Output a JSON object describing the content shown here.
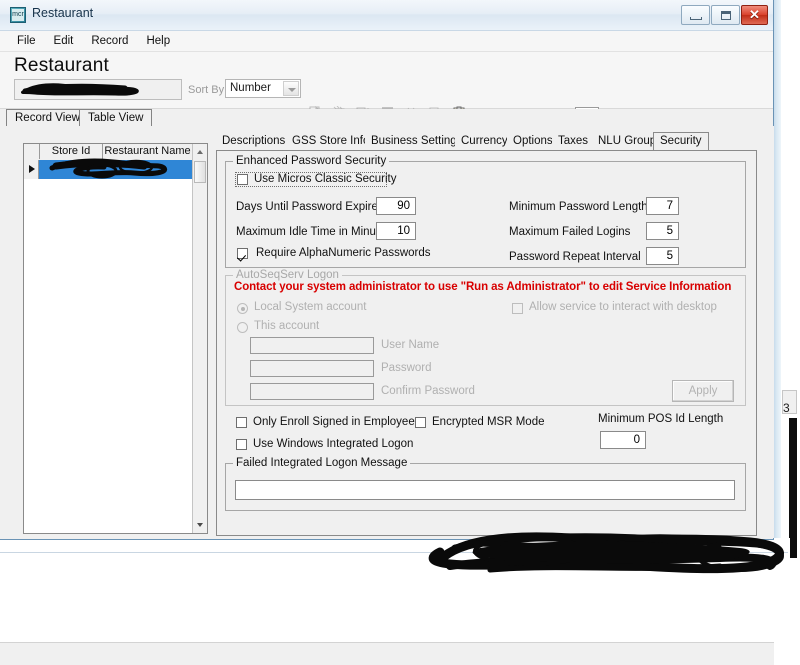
{
  "window": {
    "title": "Restaurant",
    "app_icon": "app-icon",
    "buttons": {
      "minimize": "minimize",
      "maximize": "maximize",
      "close": "close"
    }
  },
  "menu": {
    "items": [
      {
        "label": "File"
      },
      {
        "label": "Edit"
      },
      {
        "label": "Record"
      },
      {
        "label": "Help"
      }
    ]
  },
  "header": {
    "title": "Restaurant",
    "record_name": "",
    "sort_by_label": "Sort By",
    "sort_by_value": "Number",
    "toolbar_top": [
      {
        "name": "new-record-icon"
      },
      {
        "name": "copy-record-icon"
      },
      {
        "name": "paste-record-icon"
      },
      {
        "name": "delete-record-icon"
      },
      {
        "name": "cut-icon"
      },
      {
        "name": "export-icon"
      },
      {
        "name": "clipboard-icon"
      },
      {
        "name": "sparkle-icon"
      }
    ],
    "toolbar_nav": [
      {
        "name": "first-record-icon"
      },
      {
        "name": "previous-record-icon"
      },
      {
        "name": "next-record-icon"
      },
      {
        "name": "last-record-icon"
      },
      {
        "name": "edit-record-icon"
      },
      {
        "name": "undo-icon"
      },
      {
        "name": "add-record-icon"
      },
      {
        "name": "remove-record-icon"
      }
    ],
    "toolbar_right_top": [
      {
        "name": "find-binoculars-icon"
      },
      {
        "name": "help-book-icon"
      },
      {
        "name": "whats-this-help-icon"
      }
    ],
    "toolbar_right_bottom": [
      {
        "name": "monitor-icon"
      },
      {
        "name": "network-sync-icon"
      }
    ]
  },
  "view_tabs": [
    {
      "label": "Record View",
      "active": true
    },
    {
      "label": "Table View",
      "active": false
    }
  ],
  "grid": {
    "columns": [
      "Store Id",
      "Restaurant Name"
    ],
    "rows": [
      {
        "store_id": "",
        "restaurant_name": ""
      }
    ]
  },
  "settings_tabs": [
    {
      "label": "Descriptions",
      "active": false
    },
    {
      "label": "GSS Store Info",
      "active": false
    },
    {
      "label": "Business Settings",
      "active": false
    },
    {
      "label": "Currency",
      "active": false
    },
    {
      "label": "Options",
      "active": false
    },
    {
      "label": "Taxes",
      "active": false
    },
    {
      "label": "NLU Groups",
      "active": false
    },
    {
      "label": "Security",
      "active": true
    }
  ],
  "security": {
    "enhanced_group_label": "Enhanced Password Security",
    "use_micros_classic_security": {
      "label": "Use Micros Classic Security",
      "checked": false
    },
    "days_until_password_expires": {
      "label": "Days Until Password Expires",
      "value": "90"
    },
    "maximum_idle_time_in_minutes": {
      "label": "Maximum Idle Time in Minutes",
      "value": "10"
    },
    "require_alphanumeric_passwords": {
      "label": "Require AlphaNumeric Passwords",
      "checked": true
    },
    "minimum_password_length": {
      "label": "Minimum Password Length",
      "value": "7"
    },
    "maximum_failed_logins": {
      "label": "Maximum Failed Logins",
      "value": "5"
    },
    "password_repeat_interval": {
      "label": "Password Repeat Interval",
      "value": "5"
    },
    "autoseqserv": {
      "group_label": "AutoSeqServ Logon",
      "warning": "Contact your system administrator to use \"Run as Administrator\" to edit Service Information",
      "warning_color": "#d80000",
      "local_system_account": {
        "label": "Local System account",
        "selected": true
      },
      "this_account": {
        "label": "This account",
        "selected": false
      },
      "allow_interact_desktop": {
        "label": "Allow service to interact with desktop",
        "checked": false
      },
      "user_name": {
        "label": "User Name",
        "value": ""
      },
      "password": {
        "label": "Password",
        "value": ""
      },
      "confirm_password": {
        "label": "Confirm Password",
        "value": ""
      },
      "apply_button": "Apply"
    },
    "only_enroll_signed_in_employee": {
      "label": "Only Enroll Signed in Employee",
      "checked": false
    },
    "use_windows_integrated_logon": {
      "label": "Use Windows Integrated Logon",
      "checked": false
    },
    "encrypted_msr_mode": {
      "label": "Encrypted MSR Mode",
      "checked": false
    },
    "minimum_pos_id_length": {
      "label": "Minimum POS Id Length",
      "value": "0"
    },
    "failed_integrated_logon_message": {
      "group_label": "Failed Integrated Logon Message",
      "value": ""
    }
  },
  "background": {
    "partial_number": "3"
  }
}
